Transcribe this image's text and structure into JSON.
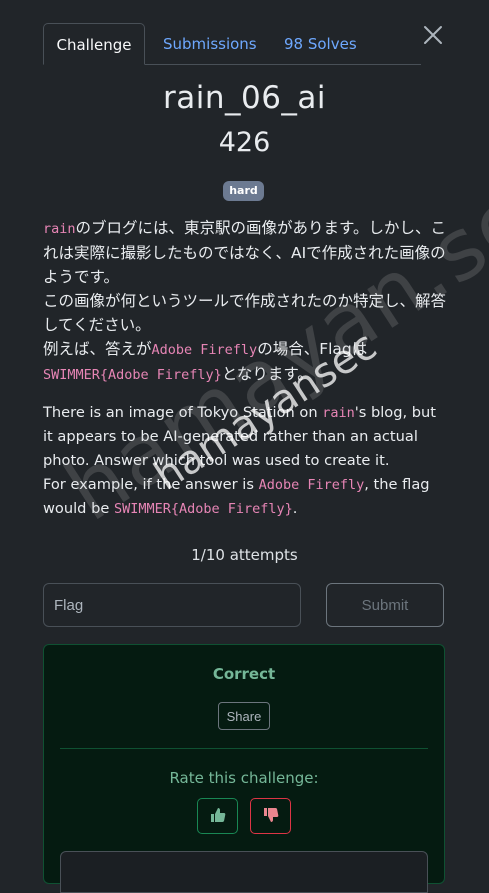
{
  "tabs": {
    "challenge": "Challenge",
    "submissions": "Submissions",
    "solves": "98 Solves"
  },
  "challenge": {
    "name": "rain_06_ai",
    "points": "426",
    "difficulty": "hard"
  },
  "description_ja": {
    "p1_code": "rain",
    "p1_text": "のブログには、東京駅の画像があります。しかし、これは実際に撮影したものではなく、AIで作成された画像のようです。",
    "p2_text": "この画像が何というツールで作成されたのか特定し、解答してください。",
    "p3_pre": "例えば、答えが",
    "p3_code1": "Adobe Firefly",
    "p3_mid": "の場合、Flagは",
    "p3_code2": "SWIMMER{Adobe Firefly}",
    "p3_post": "となります。"
  },
  "description_en": {
    "p1_pre": "There is an image of Tokyo Station on ",
    "p1_code": "rain",
    "p1_post": "'s blog, but it appears to be AI-generated rather than an actual photo. Answer which tool was used to create it.",
    "p2_pre": "For example, if the answer is ",
    "p2_code1": "Adobe Firefly",
    "p2_mid": ", the flag would be ",
    "p2_code2": "SWIMMER{Adobe Firefly}",
    "p2_post": "."
  },
  "attempts": "1/10 attempts",
  "form": {
    "flag_placeholder": "Flag",
    "submit_label": "Submit"
  },
  "result": {
    "status": "Correct",
    "share_label": "Share",
    "rate_prompt": "Rate this challenge:"
  },
  "watermark": {
    "large": "hamayan.sec",
    "small": "hamayansec"
  },
  "colors": {
    "background": "#212529",
    "link": "#6ea8fe",
    "code": "#e685b5",
    "success": "#75b798",
    "danger": "#dc3545"
  }
}
